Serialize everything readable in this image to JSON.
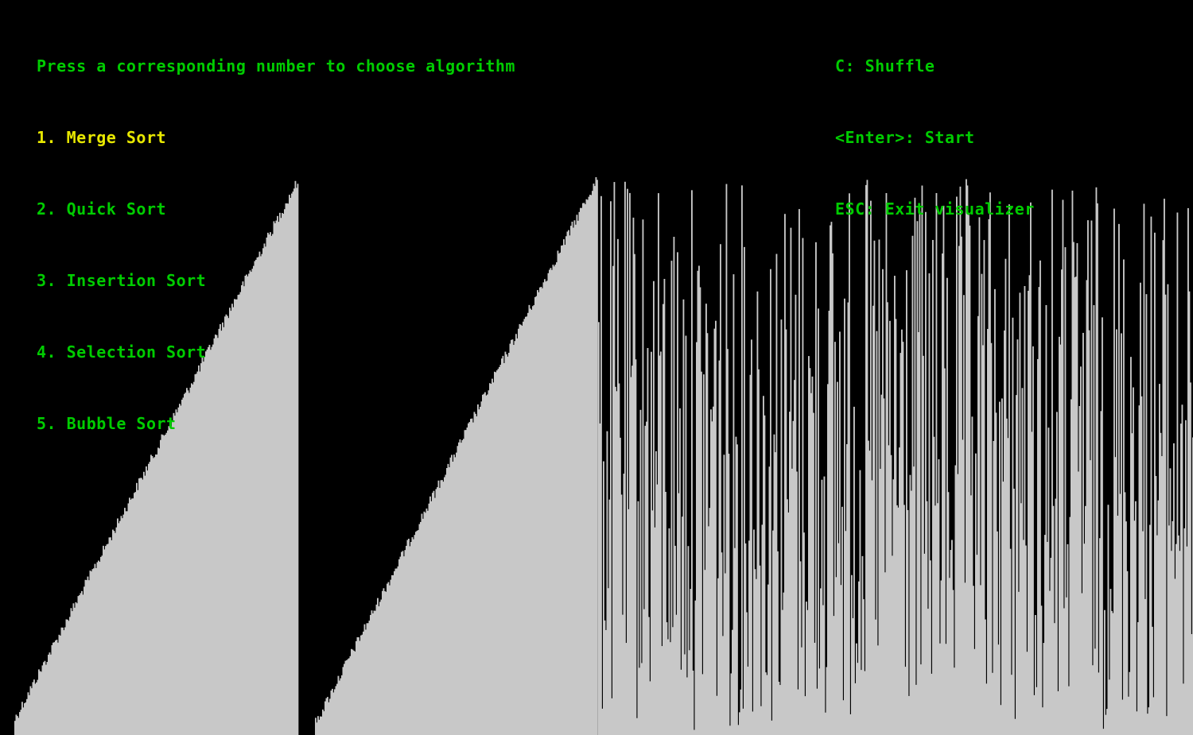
{
  "colors": {
    "background": "#000000",
    "text": "#00cc00",
    "selected": "#e8e800",
    "bar": "#c8c8c8"
  },
  "instructions": {
    "prompt": "Press a corresponding number to choose algorithm",
    "algorithms": [
      {
        "label": "1. Merge Sort",
        "selected": true
      },
      {
        "label": "2. Quick Sort",
        "selected": false
      },
      {
        "label": "3. Insertion Sort",
        "selected": false
      },
      {
        "label": "4. Selection Sort",
        "selected": false
      },
      {
        "label": "5. Bubble Sort",
        "selected": false
      }
    ]
  },
  "controls": {
    "shuffle": "C: Shuffle",
    "start": "<Enter>: Start",
    "exit": "ESC: Exit visualizer"
  }
}
